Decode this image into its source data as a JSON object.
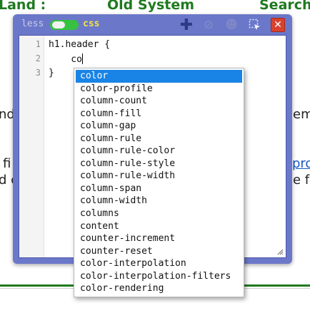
{
  "background_page": {
    "heading_left": "Land :",
    "heading_center": "Old System",
    "heading_right": "Search",
    "fragment_1": "nd",
    "fragment_2": "emp",
    "fragment_3": "fi",
    "fragment_4": "d c",
    "fragment_5": "pro",
    "fragment_6": "e fo"
  },
  "toolbar": {
    "less_label": "less",
    "css_label": "css",
    "toggle_state": "css",
    "plus_glyph": "✚",
    "disable_glyph": "⊘",
    "smile_glyph": "☻",
    "select_glyph": "⬚",
    "close_glyph": "✕"
  },
  "editor": {
    "lines": [
      {
        "num": "1",
        "text": "h1.header {"
      },
      {
        "num": "2",
        "text": "    co"
      },
      {
        "num": "3",
        "text": "}"
      }
    ]
  },
  "autocomplete": {
    "selected_index": 0,
    "items": [
      "color",
      "color-profile",
      "column-count",
      "column-fill",
      "column-gap",
      "column-rule",
      "column-rule-color",
      "column-rule-style",
      "column-rule-width",
      "column-span",
      "column-width",
      "columns",
      "content",
      "counter-increment",
      "counter-reset",
      "color-interpolation",
      "color-interpolation-filters",
      "color-rendering"
    ]
  },
  "colors": {
    "window_frame": "#6b78c9",
    "toggle_on": "#38c140",
    "css_label": "#f0e24a",
    "selection": "#1a84e6",
    "close_button": "#d9412f",
    "page_heading": "#1f7a1f"
  }
}
